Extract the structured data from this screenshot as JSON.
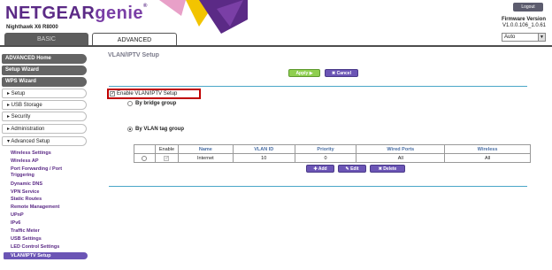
{
  "header": {
    "logo_netgear": "NETGEAR",
    "logo_genie": "genie",
    "logo_tm": "®",
    "model": "Nighthawk X6 R8000",
    "logout": "Logout",
    "firmware_label": "Firmware Version",
    "firmware_value": "V1.0.0.106_1.0.61",
    "language": "Auto",
    "brand_color": "#5b2a86"
  },
  "tabs": {
    "basic": "BASIC",
    "advanced": "ADVANCED"
  },
  "sidebar": {
    "advanced_home": "ADVANCED Home",
    "setup_wizard": "Setup Wizard",
    "wps_wizard": "WPS Wizard",
    "setup": "▸ Setup",
    "usb_storage": "▸ USB Storage",
    "security": "▸ Security",
    "administration": "▸ Administration",
    "advanced_setup": "▾ Advanced Setup",
    "sub_items": [
      "Wireless Settings",
      "Wireless AP",
      "Port Forwarding / Port",
      "Triggering",
      "Dynamic DNS",
      "VPN Service",
      "Static Routes",
      "Remote Management",
      "UPnP",
      "IPv6",
      "Traffic Meter",
      "USB Settings",
      "LED Control Settings",
      "VLAN/IPTV Setup"
    ]
  },
  "main": {
    "title": "VLAN/IPTV Setup",
    "apply": "Apply ▶",
    "cancel": "✖ Cancel",
    "enable_label": "Enable VLAN/IPTV Setup",
    "bridge_label": "By bridge group",
    "tag_label": "By VLAN tag group",
    "table": {
      "headers": [
        "",
        "Enable",
        "Name",
        "VLAN ID",
        "Priority",
        "Wired Ports",
        "Wireless"
      ],
      "rows": [
        [
          "",
          "",
          "Internet",
          "10",
          "0",
          "All",
          "All"
        ]
      ]
    },
    "add": "✚ Add",
    "edit": "✎ Edit",
    "delete": "✖ Delete"
  }
}
